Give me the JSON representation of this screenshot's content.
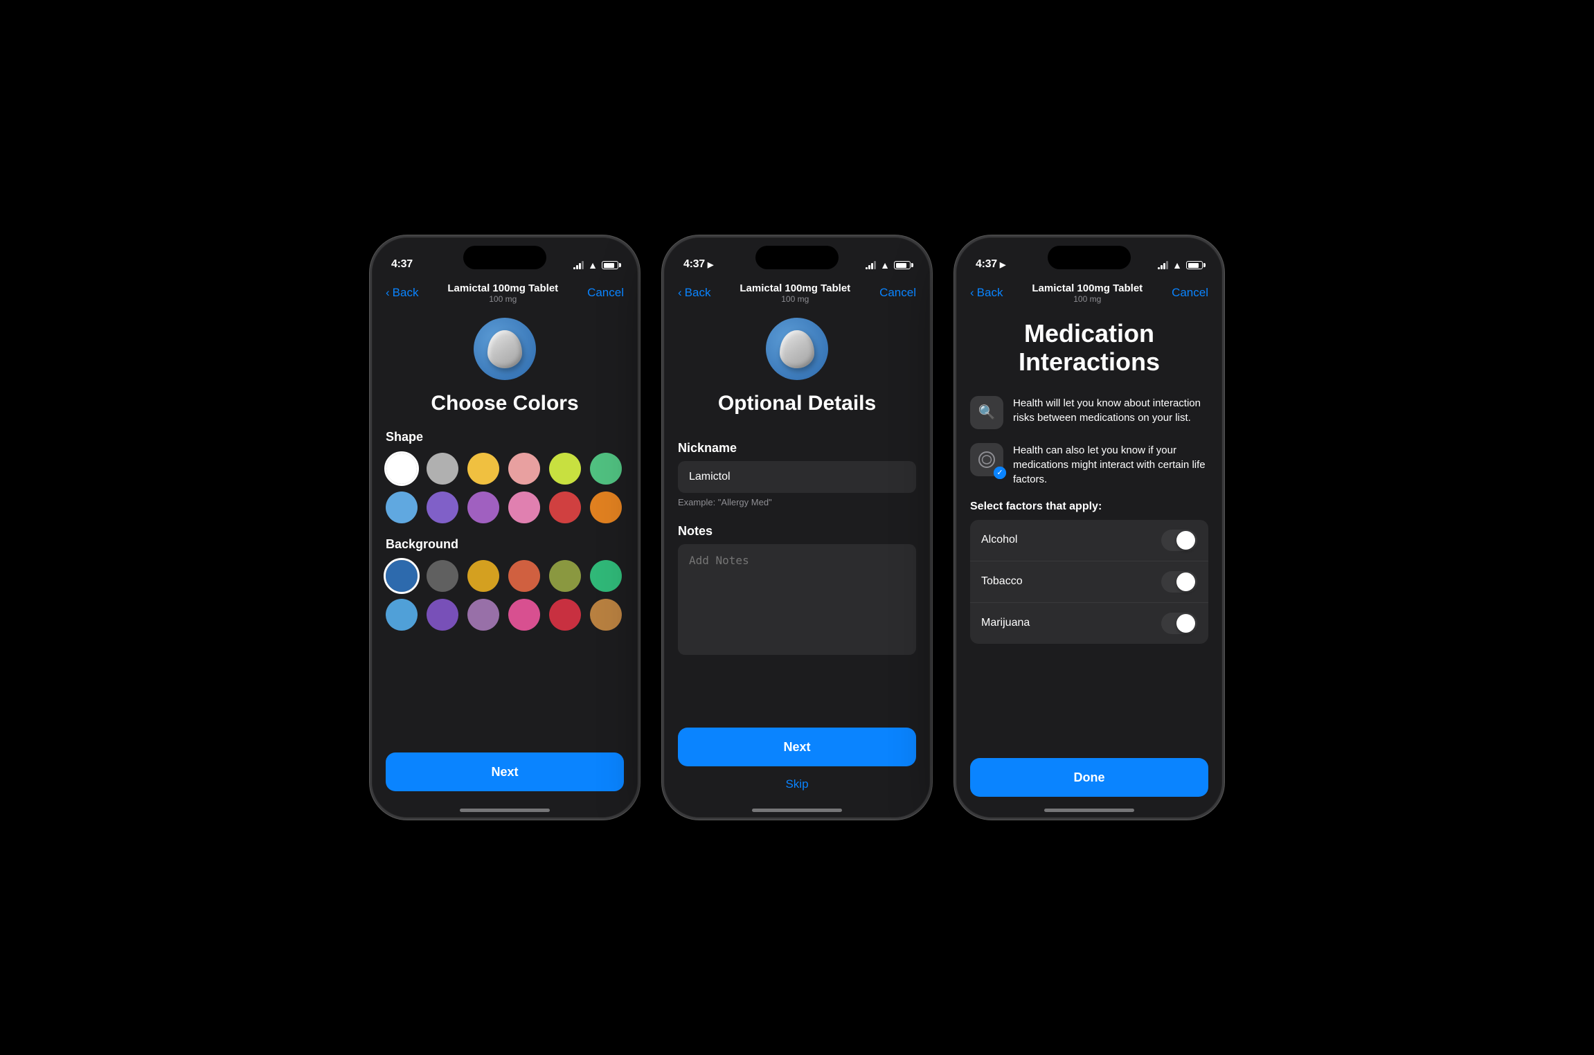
{
  "phones": [
    {
      "id": "phone1",
      "screen": "choose-colors",
      "status_time": "4:37",
      "has_location": false,
      "nav": {
        "back_label": "Back",
        "title": "Lamictal 100mg Tablet",
        "subtitle": "100 mg",
        "cancel_label": "Cancel"
      },
      "pill_icon": "pill",
      "title": "Choose Colors",
      "shape_label": "Shape",
      "background_label": "Background",
      "shape_colors": [
        {
          "id": "white",
          "color": "#ffffff",
          "selected": true
        },
        {
          "id": "light-gray",
          "color": "#b0b0b0"
        },
        {
          "id": "yellow",
          "color": "#f0c040"
        },
        {
          "id": "pink",
          "color": "#e8a0a0"
        },
        {
          "id": "yellow-green",
          "color": "#c8e040"
        },
        {
          "id": "green",
          "color": "#50c080"
        },
        {
          "id": "light-blue",
          "color": "#60a8e0"
        },
        {
          "id": "purple-blue",
          "color": "#8060c8"
        },
        {
          "id": "purple",
          "color": "#a060c0"
        },
        {
          "id": "light-pink",
          "color": "#e080b0"
        },
        {
          "id": "red",
          "color": "#d04040"
        },
        {
          "id": "orange",
          "color": "#e08020"
        }
      ],
      "background_colors": [
        {
          "id": "dark-blue",
          "color": "#2d6aad",
          "selected": true
        },
        {
          "id": "dark-gray",
          "color": "#606060"
        },
        {
          "id": "gold",
          "color": "#d4a020"
        },
        {
          "id": "coral",
          "color": "#d06040"
        },
        {
          "id": "olive",
          "color": "#8a9840"
        },
        {
          "id": "teal-green",
          "color": "#30b878"
        },
        {
          "id": "sky-blue",
          "color": "#50a0d8"
        },
        {
          "id": "violet",
          "color": "#7850b8"
        },
        {
          "id": "mauve",
          "color": "#9870a8"
        },
        {
          "id": "hot-pink",
          "color": "#d85090"
        },
        {
          "id": "crimson",
          "color": "#c83040"
        },
        {
          "id": "tan",
          "color": "#b88040"
        }
      ],
      "next_label": "Next"
    },
    {
      "id": "phone2",
      "screen": "optional-details",
      "status_time": "4:37",
      "has_location": true,
      "nav": {
        "back_label": "Back",
        "title": "Lamictal 100mg Tablet",
        "subtitle": "100 mg",
        "cancel_label": "Cancel"
      },
      "pill_icon": "pill",
      "title": "Optional Details",
      "nickname_label": "Nickname",
      "nickname_value": "Lamictol",
      "nickname_hint": "Example: \"Allergy Med\"",
      "notes_label": "Notes",
      "notes_placeholder": "Add Notes",
      "next_label": "Next",
      "skip_label": "Skip"
    },
    {
      "id": "phone3",
      "screen": "medication-interactions",
      "status_time": "4:37",
      "has_location": true,
      "nav": {
        "back_label": "Back",
        "title": "Lamictal 100mg Tablet",
        "subtitle": "100 mg",
        "cancel_label": "Cancel"
      },
      "title_line1": "Medication",
      "title_line2": "Interactions",
      "info_items": [
        {
          "icon": "search",
          "checked": false,
          "text": "Health will let you know about interaction risks between medications on your list."
        },
        {
          "icon": "interactions",
          "checked": true,
          "text": "Health can also let you know if your medications might interact with certain life factors."
        }
      ],
      "factors_label": "Select factors that apply:",
      "factors": [
        {
          "name": "Alcohol",
          "enabled": false
        },
        {
          "name": "Tobacco",
          "enabled": false
        },
        {
          "name": "Marijuana",
          "enabled": false
        }
      ],
      "done_label": "Done"
    }
  ]
}
